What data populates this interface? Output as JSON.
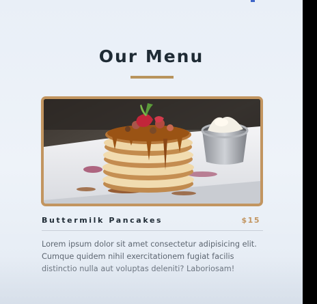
{
  "menu": {
    "title": "Our Menu",
    "accent_color": "#c29560",
    "items": [
      {
        "name": "Buttermilk Pancakes",
        "price": "$15",
        "image": "buttermilk-pancakes-photo",
        "description": "Lorem ipsum dolor sit amet consectetur adipisicing elit. Cumque quidem nihil exercitationem fugiat facilis distinctio nulla aut voluptas deleniti? Laboriosam!"
      }
    ]
  }
}
